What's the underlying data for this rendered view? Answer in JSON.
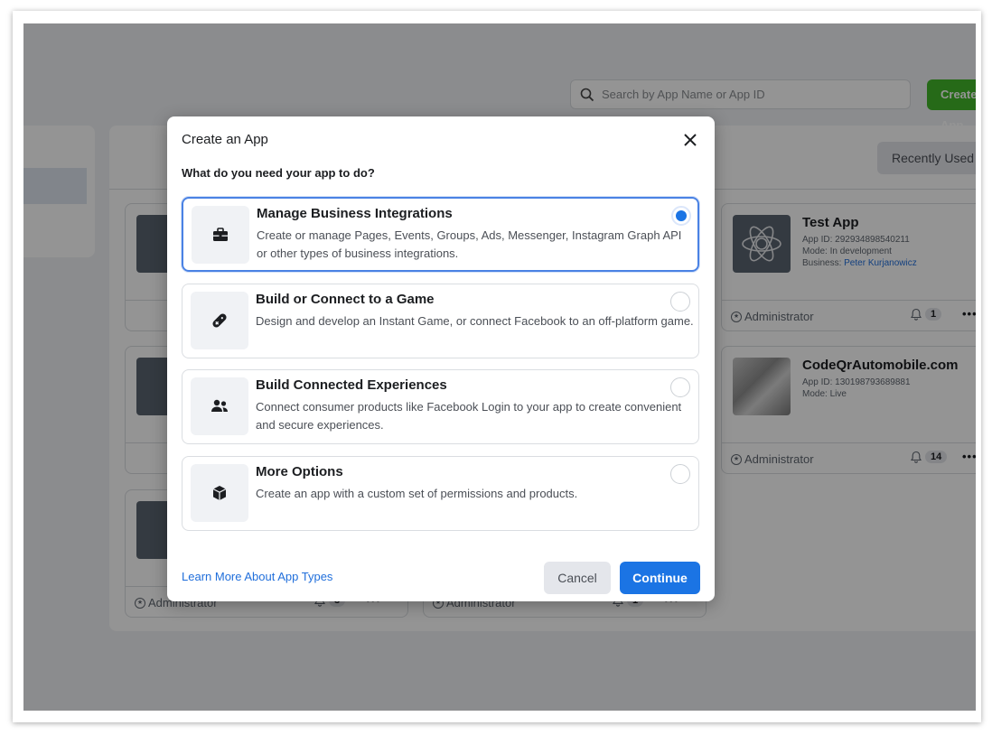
{
  "search": {
    "placeholder": "Search by App Name or App ID"
  },
  "header": {
    "create_label": "Create App"
  },
  "filter": {
    "recent_label": "Recently Used"
  },
  "apps": [
    {
      "name": "Test App",
      "id_line": "App ID: 292934898540211",
      "mode_line": "Mode: In development",
      "business_label": "Business: ",
      "business_name": "Peter Kurjanowicz",
      "role": "Administrator",
      "notifications": "1"
    },
    {
      "name": "CodeQrAutomobile.com",
      "id_line": "App ID: 130198793689881",
      "mode_line": "Mode: Live",
      "role": "Administrator",
      "notifications": "14"
    },
    {
      "role": "Administrator",
      "notifications": "3"
    },
    {
      "role": "Administrator",
      "notifications": "1"
    }
  ],
  "modal": {
    "title": "Create an App",
    "question": "What do you need your app to do?",
    "options": [
      {
        "title": "Manage Business Integrations",
        "desc": "Create or manage Pages, Events, Groups, Ads, Messenger, Instagram Graph API or other types of business integrations.",
        "icon": "briefcase-icon",
        "selected": true
      },
      {
        "title": "Build or Connect to a Game",
        "desc": "Design and develop an Instant Game, or connect Facebook to an off-platform game.",
        "icon": "game-controller-icon",
        "selected": false
      },
      {
        "title": "Build Connected Experiences",
        "desc": "Connect consumer products like Facebook Login to your app to create convenient and secure experiences.",
        "icon": "people-icon",
        "selected": false
      },
      {
        "title": "More Options",
        "desc": "Create an app with a custom set of permissions and products.",
        "icon": "cube-icon",
        "selected": false
      }
    ],
    "learn_more": "Learn More About App Types",
    "cancel_label": "Cancel",
    "continue_label": "Continue"
  },
  "colors": {
    "primary": "#1b74e4",
    "create_green": "#42b72a",
    "overlay": "rgba(0,0,0,0.42)"
  }
}
